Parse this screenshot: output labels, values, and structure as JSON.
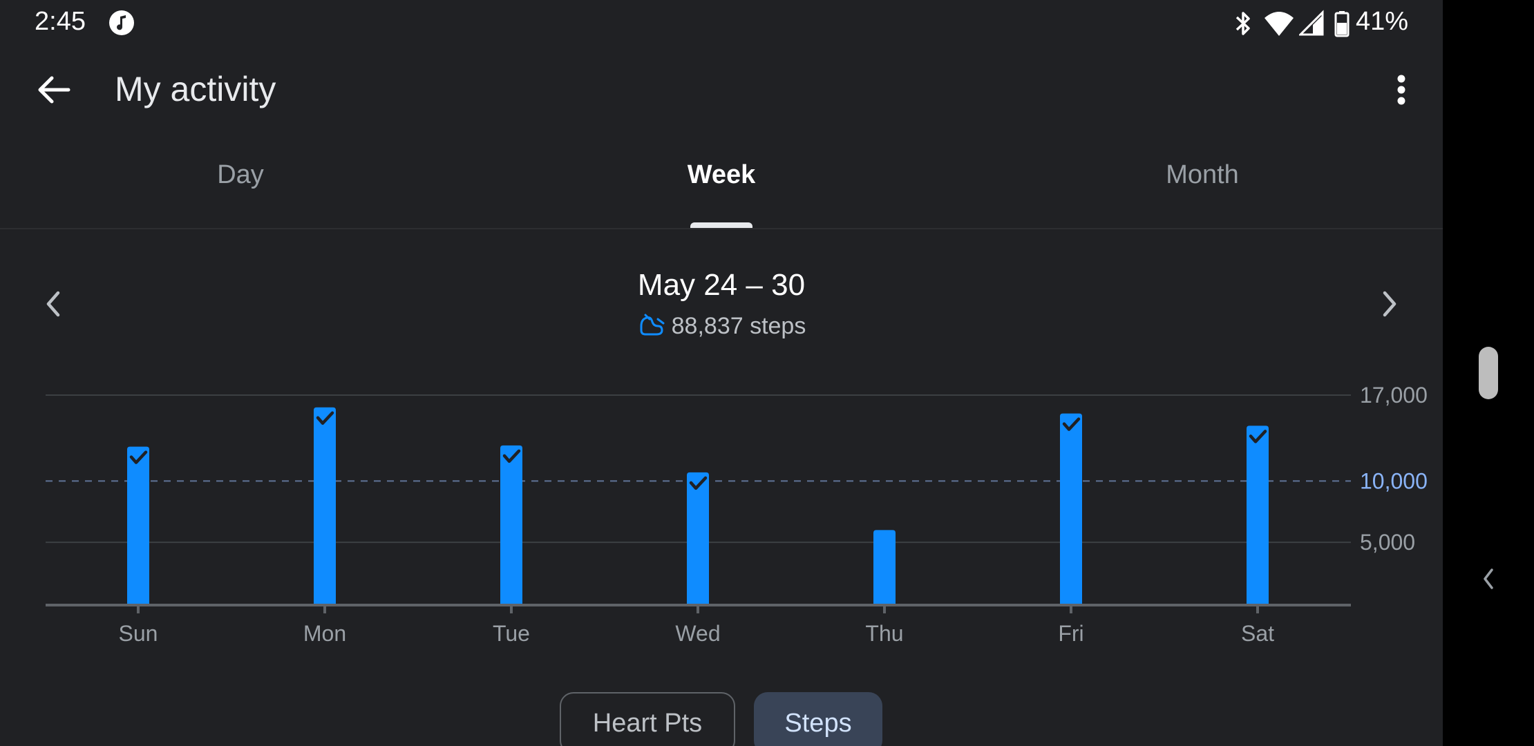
{
  "status_bar": {
    "time": "2:45",
    "battery_percent": "41%",
    "icons": [
      "music-icon",
      "bluetooth-icon",
      "wifi-icon",
      "cellular-icon",
      "battery-icon"
    ]
  },
  "app_bar": {
    "title": "My activity",
    "back_icon": "arrow-back-icon",
    "menu_icon": "more-vert-icon"
  },
  "tabs": [
    {
      "label": "Day",
      "active": false
    },
    {
      "label": "Week",
      "active": true
    },
    {
      "label": "Month",
      "active": false
    }
  ],
  "period": {
    "range": "May 24 – 30",
    "total": "88,837 steps",
    "total_icon": "steps-icon",
    "prev_icon": "chevron-left-icon",
    "next_icon": "chevron-right-icon"
  },
  "chart_data": {
    "type": "bar",
    "categories": [
      "Sun",
      "Mon",
      "Tue",
      "Wed",
      "Thu",
      "Fri",
      "Sat"
    ],
    "values": [
      12800,
      16000,
      12900,
      10700,
      6000,
      15500,
      14500
    ],
    "goal": 10000,
    "goal_label": "10,000",
    "goal_met": [
      true,
      true,
      true,
      true,
      false,
      true,
      true
    ],
    "y_ticks": [
      {
        "value": 17000,
        "label": "17,000"
      },
      {
        "value": 5000,
        "label": "5,000"
      }
    ],
    "ylim": [
      0,
      17000
    ],
    "bar_color": "#0f8cff",
    "goal_color": "#8ab4f8"
  },
  "metric_chips": [
    {
      "label": "Heart Pts",
      "selected": false
    },
    {
      "label": "Steps",
      "selected": true
    }
  ],
  "colors": {
    "background": "#202124",
    "accent": "#0f8cff",
    "chip_selected": "#394457"
  }
}
